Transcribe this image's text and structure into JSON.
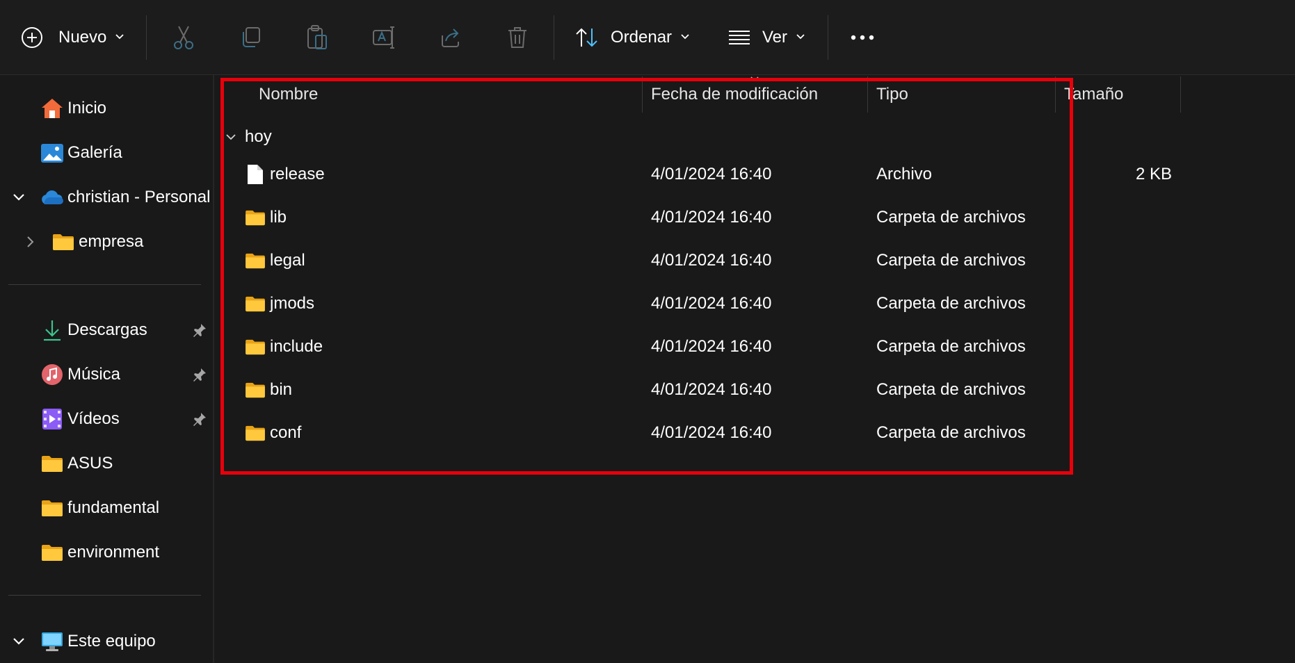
{
  "toolbar": {
    "new_label": "Nuevo",
    "sort_label": "Ordenar",
    "view_label": "Ver",
    "icons": [
      "plus-circle-icon",
      "cut-icon",
      "copy-icon",
      "paste-icon",
      "rename-icon",
      "share-icon",
      "delete-icon",
      "sort-icon",
      "view-lines-icon",
      "more-icon"
    ]
  },
  "sidebar": {
    "items": [
      {
        "label": "Inicio",
        "icon": "home-icon"
      },
      {
        "label": "Galería",
        "icon": "gallery-icon"
      },
      {
        "label": "christian - Personal",
        "icon": "onedrive-cloud-icon",
        "expanded": true
      },
      {
        "label": "empresa",
        "icon": "folder-icon",
        "expanded": false
      },
      {
        "label": "Descargas",
        "icon": "download-icon",
        "pinned": true
      },
      {
        "label": "Música",
        "icon": "music-icon",
        "pinned": true
      },
      {
        "label": "Vídeos",
        "icon": "video-icon",
        "pinned": true
      },
      {
        "label": "ASUS",
        "icon": "folder-icon"
      },
      {
        "label": "fundamental",
        "icon": "folder-icon"
      },
      {
        "label": "environment",
        "icon": "folder-icon"
      },
      {
        "label": "Este equipo",
        "icon": "computer-icon",
        "expanded": true
      }
    ]
  },
  "columns": {
    "name": "Nombre",
    "modified": "Fecha de modificación",
    "type": "Tipo",
    "size": "Tamaño"
  },
  "group": {
    "label": "hoy"
  },
  "files": [
    {
      "name": "release",
      "modified": "4/01/2024 16:40",
      "type": "Archivo",
      "size": "2 KB",
      "icon": "file-icon"
    },
    {
      "name": "lib",
      "modified": "4/01/2024 16:40",
      "type": "Carpeta de archivos",
      "size": "",
      "icon": "folder-icon"
    },
    {
      "name": "legal",
      "modified": "4/01/2024 16:40",
      "type": "Carpeta de archivos",
      "size": "",
      "icon": "folder-icon"
    },
    {
      "name": "jmods",
      "modified": "4/01/2024 16:40",
      "type": "Carpeta de archivos",
      "size": "",
      "icon": "folder-icon"
    },
    {
      "name": "include",
      "modified": "4/01/2024 16:40",
      "type": "Carpeta de archivos",
      "size": "",
      "icon": "folder-icon"
    },
    {
      "name": "bin",
      "modified": "4/01/2024 16:40",
      "type": "Carpeta de archivos",
      "size": "",
      "icon": "folder-icon"
    },
    {
      "name": "conf",
      "modified": "4/01/2024 16:40",
      "type": "Carpeta de archivos",
      "size": "",
      "icon": "folder-icon"
    }
  ],
  "colors": {
    "highlight_border": "#e8000b",
    "folder_yellow": "#ffc83d",
    "accent_blue": "#4cc2ff"
  }
}
